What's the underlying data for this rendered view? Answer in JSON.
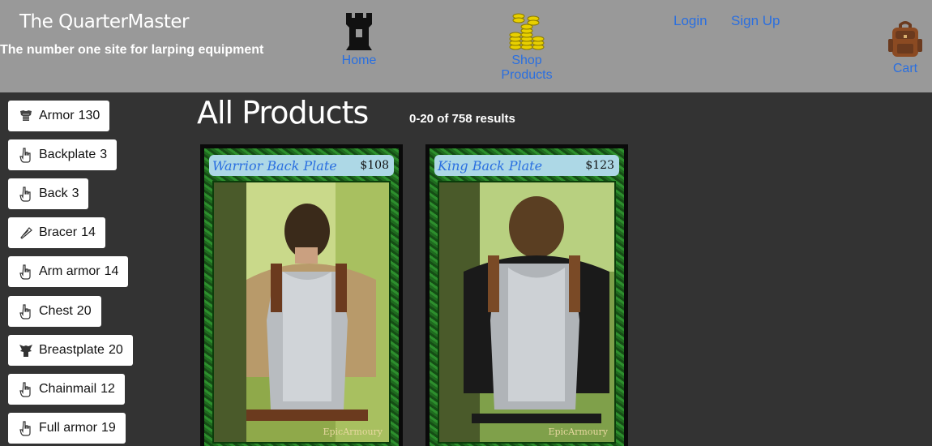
{
  "header": {
    "title": "The QuarterMaster",
    "tagline": "The number one site for larping equipment",
    "nav": {
      "home": "Home",
      "shop": "Shop Products",
      "login": "Login",
      "signup": "Sign Up",
      "cart": "Cart"
    },
    "icons": {
      "home": "castle-tower-icon",
      "shop": "gold-coins-icon",
      "cart": "backpack-icon"
    }
  },
  "sidebar": {
    "categories": [
      {
        "label": "Armor",
        "count": "130",
        "icon": "armor-icon"
      },
      {
        "label": "Backplate",
        "count": "3",
        "icon": "hand-pointer-icon"
      },
      {
        "label": "Back",
        "count": "3",
        "icon": "hand-pointer-icon"
      },
      {
        "label": "Bracer",
        "count": "14",
        "icon": "bracer-icon"
      },
      {
        "label": "Arm armor",
        "count": "14",
        "icon": "hand-pointer-icon"
      },
      {
        "label": "Chest",
        "count": "20",
        "icon": "hand-pointer-icon"
      },
      {
        "label": "Breastplate",
        "count": "20",
        "icon": "breastplate-icon"
      },
      {
        "label": "Chainmail",
        "count": "12",
        "icon": "hand-pointer-icon"
      },
      {
        "label": "Full armor",
        "count": "19",
        "icon": "hand-pointer-icon"
      }
    ]
  },
  "main": {
    "title": "All Products",
    "results": "0-20 of 758 results",
    "products": [
      {
        "name": "Warrior Back Plate",
        "price": "$108",
        "watermark": "EpicArmoury"
      },
      {
        "name": "King Back Plate",
        "price": "$123",
        "watermark": "EpicArmoury"
      }
    ]
  },
  "colors": {
    "header_bg": "#999999",
    "page_bg": "#333333",
    "link": "#2a6fe0",
    "card_frame": "#2d8f2d",
    "card_title_bg": "#add8e6"
  }
}
